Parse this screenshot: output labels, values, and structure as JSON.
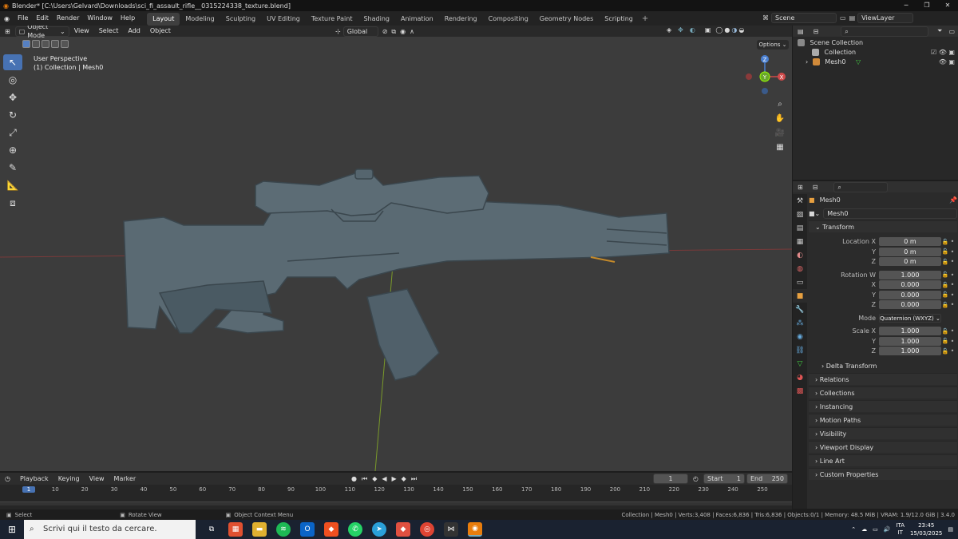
{
  "window": {
    "title": "Blender* [C:\\Users\\Gelvard\\Downloads\\sci_fi_assault_rifle__0315224338_texture.blend]"
  },
  "menu": {
    "items": [
      "File",
      "Edit",
      "Render",
      "Window",
      "Help"
    ]
  },
  "workspaces": [
    "Layout",
    "Modeling",
    "Sculpting",
    "UV Editing",
    "Texture Paint",
    "Shading",
    "Animation",
    "Rendering",
    "Compositing",
    "Geometry Nodes",
    "Scripting"
  ],
  "active_workspace": "Layout",
  "scene": {
    "label": "Scene",
    "viewlayer": "ViewLayer"
  },
  "viewport": {
    "mode": "Object Mode",
    "header_menu": [
      "View",
      "Select",
      "Add",
      "Object"
    ],
    "orientation": "Global",
    "options": "Options",
    "perspective": "User Perspective",
    "collection_info": "(1) Collection | Mesh0",
    "gizmo": {
      "z": "Z",
      "y": "Y",
      "x": "X"
    }
  },
  "outliner": {
    "scene_collection": "Scene Collection",
    "collection": "Collection",
    "object": "Mesh0"
  },
  "properties": {
    "object_name": "Mesh0",
    "data_name": "Mesh0",
    "transform_label": "Transform",
    "location": {
      "label": "Location X",
      "x": "0 m",
      "y": "0 m",
      "z": "0 m",
      "y_lbl": "Y",
      "z_lbl": "Z"
    },
    "rotation": {
      "label": "Rotation W",
      "w": "1.000",
      "x": "0.000",
      "y": "0.000",
      "z": "0.000",
      "x_lbl": "X",
      "y_lbl": "Y",
      "z_lbl": "Z"
    },
    "mode": {
      "label": "Mode",
      "value": "Quaternion (WXYZ)"
    },
    "scale": {
      "label": "Scale X",
      "x": "1.000",
      "y": "1.000",
      "z": "1.000",
      "y_lbl": "Y",
      "z_lbl": "Z"
    },
    "delta": "Delta Transform",
    "sections": [
      "Relations",
      "Collections",
      "Instancing",
      "Motion Paths",
      "Visibility",
      "Viewport Display",
      "Line Art",
      "Custom Properties"
    ]
  },
  "timeline": {
    "menu": [
      "Playback",
      "Keying",
      "View",
      "Marker"
    ],
    "current_frame": "1",
    "start_label": "Start",
    "start": "1",
    "end_label": "End",
    "end": "250",
    "ticks": [
      "1",
      "10",
      "20",
      "30",
      "40",
      "50",
      "60",
      "70",
      "80",
      "90",
      "100",
      "110",
      "120",
      "130",
      "140",
      "150",
      "160",
      "170",
      "180",
      "190",
      "200",
      "210",
      "220",
      "230",
      "240",
      "250"
    ]
  },
  "statusbar": {
    "select": "Select",
    "rotate": "Rotate View",
    "context": "Object Context Menu",
    "stats": "Collection | Mesh0 | Verts:3,408 | Faces:6,836 | Tris:6,836 | Objects:0/1 | Memory: 48.5 MiB | VRAM: 1.9/12.0 GiB | 3.4.0"
  },
  "taskbar": {
    "search_placeholder": "Scrivi qui il testo da cercare.",
    "lang": "ITA",
    "lang2": "IT",
    "time": "23:45",
    "date": "15/03/2025"
  }
}
